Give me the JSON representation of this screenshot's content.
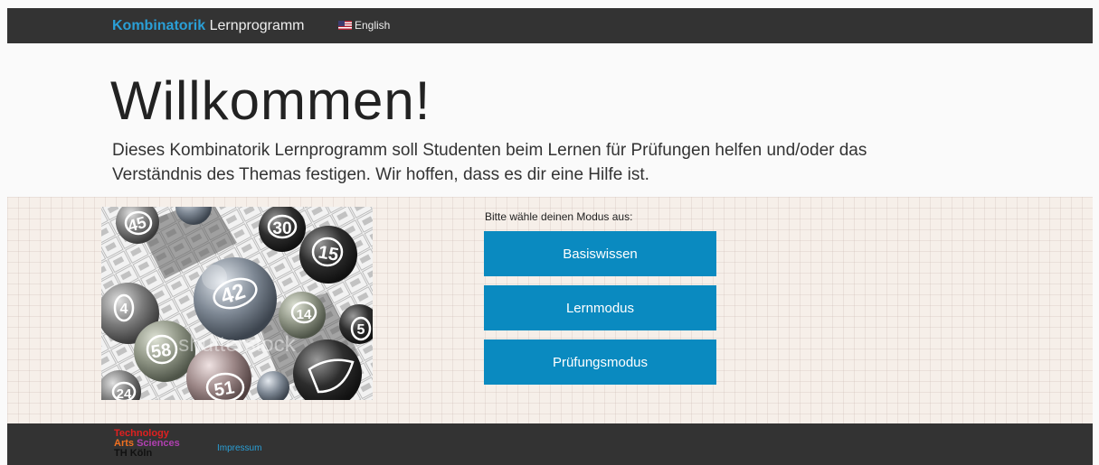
{
  "navbar": {
    "brand_highlight": "Kombinatorik",
    "brand_rest": "Lernprogramm",
    "language_label": "English",
    "language_icon": "us-flag-icon"
  },
  "hero": {
    "title": "Willkommen!",
    "lead": "Dieses Kombinatorik Lernprogramm soll Studenten beim Lernen für Prüfungen helfen und/oder das Verständnis des Themas festigen. Wir hoffen, dass es dir eine Hilfe ist."
  },
  "image": {
    "ball_numbers": [
      "45",
      "30",
      "42",
      "15",
      "14",
      "58",
      "51",
      "24",
      "5",
      "4"
    ],
    "watermark": "shutterstock"
  },
  "modes": {
    "prompt": "Bitte wähle deinen Modus aus:",
    "buttons": [
      "Basiswissen",
      "Lernmodus",
      "Prüfungsmodus"
    ]
  },
  "footer": {
    "logo_line1": "Technology",
    "logo_line2a": "Arts",
    "logo_line2b": "Sciences",
    "logo_line3": "TH Köln",
    "impressum": "Impressum"
  },
  "colors": {
    "navbar_bg": "#333333",
    "brand_accent": "#2a9fd6",
    "button_bg": "#0a8ac0",
    "background": "#fafafa"
  }
}
